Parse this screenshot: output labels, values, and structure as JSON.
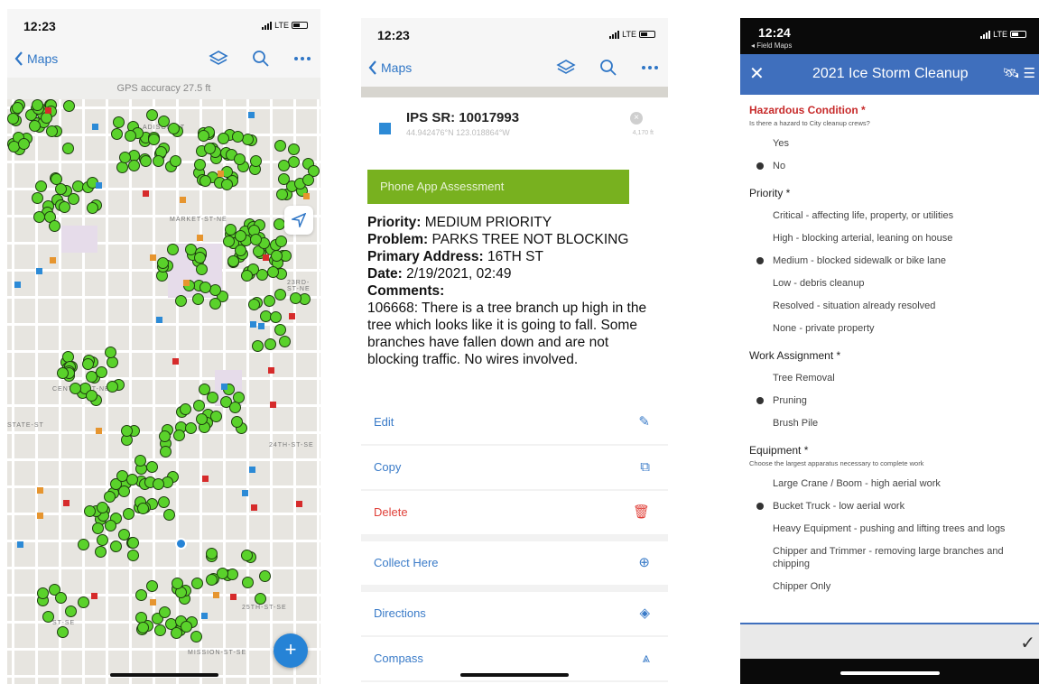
{
  "screen_map": {
    "time": "12:23",
    "carrier": "LTE",
    "back_label": "Maps",
    "gps_text": "GPS accuracy 27.5 ft",
    "icons": [
      "layers-icon",
      "search-icon",
      "more-icon",
      "locate-arrow-icon",
      "add-icon"
    ],
    "fab_label": "+",
    "accent_color": "#2683d6",
    "dot_color": "#5ad22b",
    "streets": [
      "MARKET-ST-NE",
      "CENTER-ST-NE",
      "STATE-ST",
      "MISSION-ST-SE",
      "ADISON-ST",
      "25TH-ST-SE",
      "23RD-ST-NE",
      "24TH-ST-SE",
      "ST-SE"
    ]
  },
  "screen_feature": {
    "time": "12:23",
    "carrier": "LTE",
    "back_label": "Maps",
    "title": "IPS SR: 10017993",
    "coords": "44.942476°N 123.018864°W",
    "distance": "4,170 ft",
    "banner": "Phone App Assessment",
    "banner_color": "#78b11f",
    "priority_label": "Priority:",
    "priority": "MEDIUM PRIORITY",
    "problem_label": "Problem:",
    "problem": "PARKS TREE NOT BLOCKING",
    "address_label": "Primary Address:",
    "address": "16TH ST",
    "date_label": "Date:",
    "date": "2/19/2021, 02:49",
    "comments_label": "Comments:",
    "comments": "106668: There is a tree branch up high in the tree which looks like it is going to fall. Some branches have fallen down and are not blocking traffic. No wires involved.",
    "actions": [
      {
        "label": "Edit",
        "icon": "pencil-icon"
      },
      {
        "label": "Copy",
        "icon": "copy-icon"
      },
      {
        "label": "Delete",
        "icon": "trash-icon"
      },
      {
        "label": "Collect Here",
        "icon": "plus-circle-icon"
      },
      {
        "label": "Directions",
        "icon": "directions-icon"
      },
      {
        "label": "Compass",
        "icon": "compass-icon"
      }
    ],
    "delete_color": "#e0413a"
  },
  "screen_form": {
    "time": "12:24",
    "carrier": "LTE",
    "app_back": "◂ Field Maps",
    "title": "2021 Ice Storm Cleanup",
    "nav_color": "#3f6fbd",
    "q1": {
      "label": "Hazardous Condition *",
      "hint": "Is there a hazard to City cleanup crews?",
      "options": [
        "Yes",
        "No"
      ],
      "selected": "No"
    },
    "q2": {
      "label": "Priority *",
      "options": [
        "Critical - affecting life, property, or utilities",
        "High - blocking arterial, leaning on house",
        "Medium - blocked sidewalk or bike lane",
        "Low - debris cleanup",
        "Resolved - situation already resolved",
        "None - private property"
      ],
      "selected": "Medium - blocked sidewalk or bike lane"
    },
    "q3": {
      "label": "Work Assignment *",
      "options": [
        "Tree Removal",
        "Pruning",
        "Brush Pile"
      ],
      "selected": "Pruning"
    },
    "q4": {
      "label": "Equipment *",
      "hint": "Choose the largest apparatus necessary to complete work",
      "options": [
        "Large Crane / Boom - high aerial work",
        "Bucket Truck - low aerial work",
        "Heavy Equipment - pushing and lifting trees and logs",
        "Chipper and Trimmer - removing large branches and chipping",
        "Chipper Only"
      ],
      "selected": "Bucket Truck - low aerial work"
    }
  }
}
